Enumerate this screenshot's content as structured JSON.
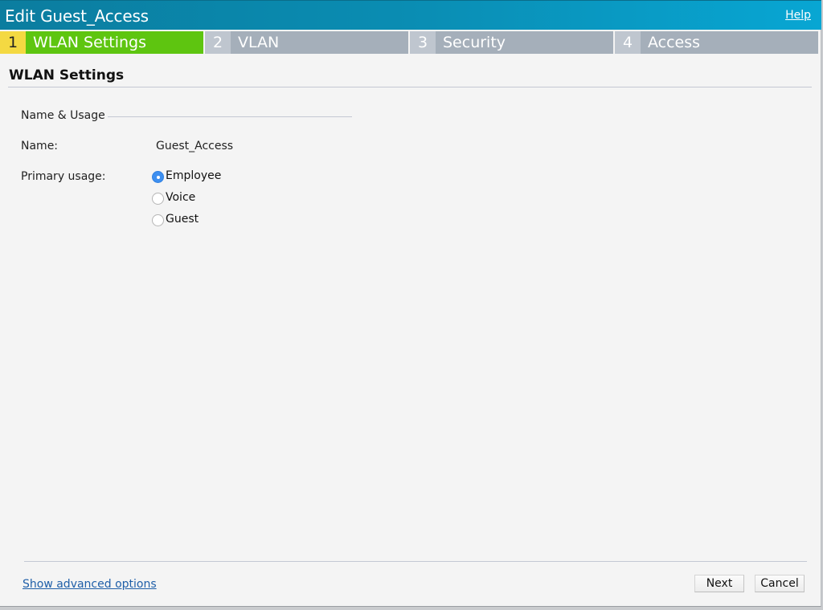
{
  "dialog": {
    "title": "Edit Guest_Access",
    "help_label": "Help"
  },
  "steps": [
    {
      "number": "1",
      "label": "WLAN Settings",
      "active": true
    },
    {
      "number": "2",
      "label": "VLAN",
      "active": false
    },
    {
      "number": "3",
      "label": "Security",
      "active": false
    },
    {
      "number": "4",
      "label": "Access",
      "active": false
    }
  ],
  "section": {
    "heading": "WLAN Settings",
    "group_legend": "Name & Usage",
    "name_label": "Name:",
    "name_value": "Guest_Access",
    "usage_label": "Primary usage:",
    "usage_options": [
      {
        "label": "Employee",
        "checked": true
      },
      {
        "label": "Voice",
        "checked": false
      },
      {
        "label": "Guest",
        "checked": false
      }
    ]
  },
  "footer": {
    "advanced_link": "Show advanced options",
    "next_label": "Next",
    "cancel_label": "Cancel"
  },
  "colors": {
    "titlebar": "#0a8db3",
    "active_step": "#5ec510",
    "active_step_number": "#f4d942",
    "inactive_step": "#a5afba",
    "link": "#1f5fa8",
    "radio_checked": "#3d8ff0"
  }
}
